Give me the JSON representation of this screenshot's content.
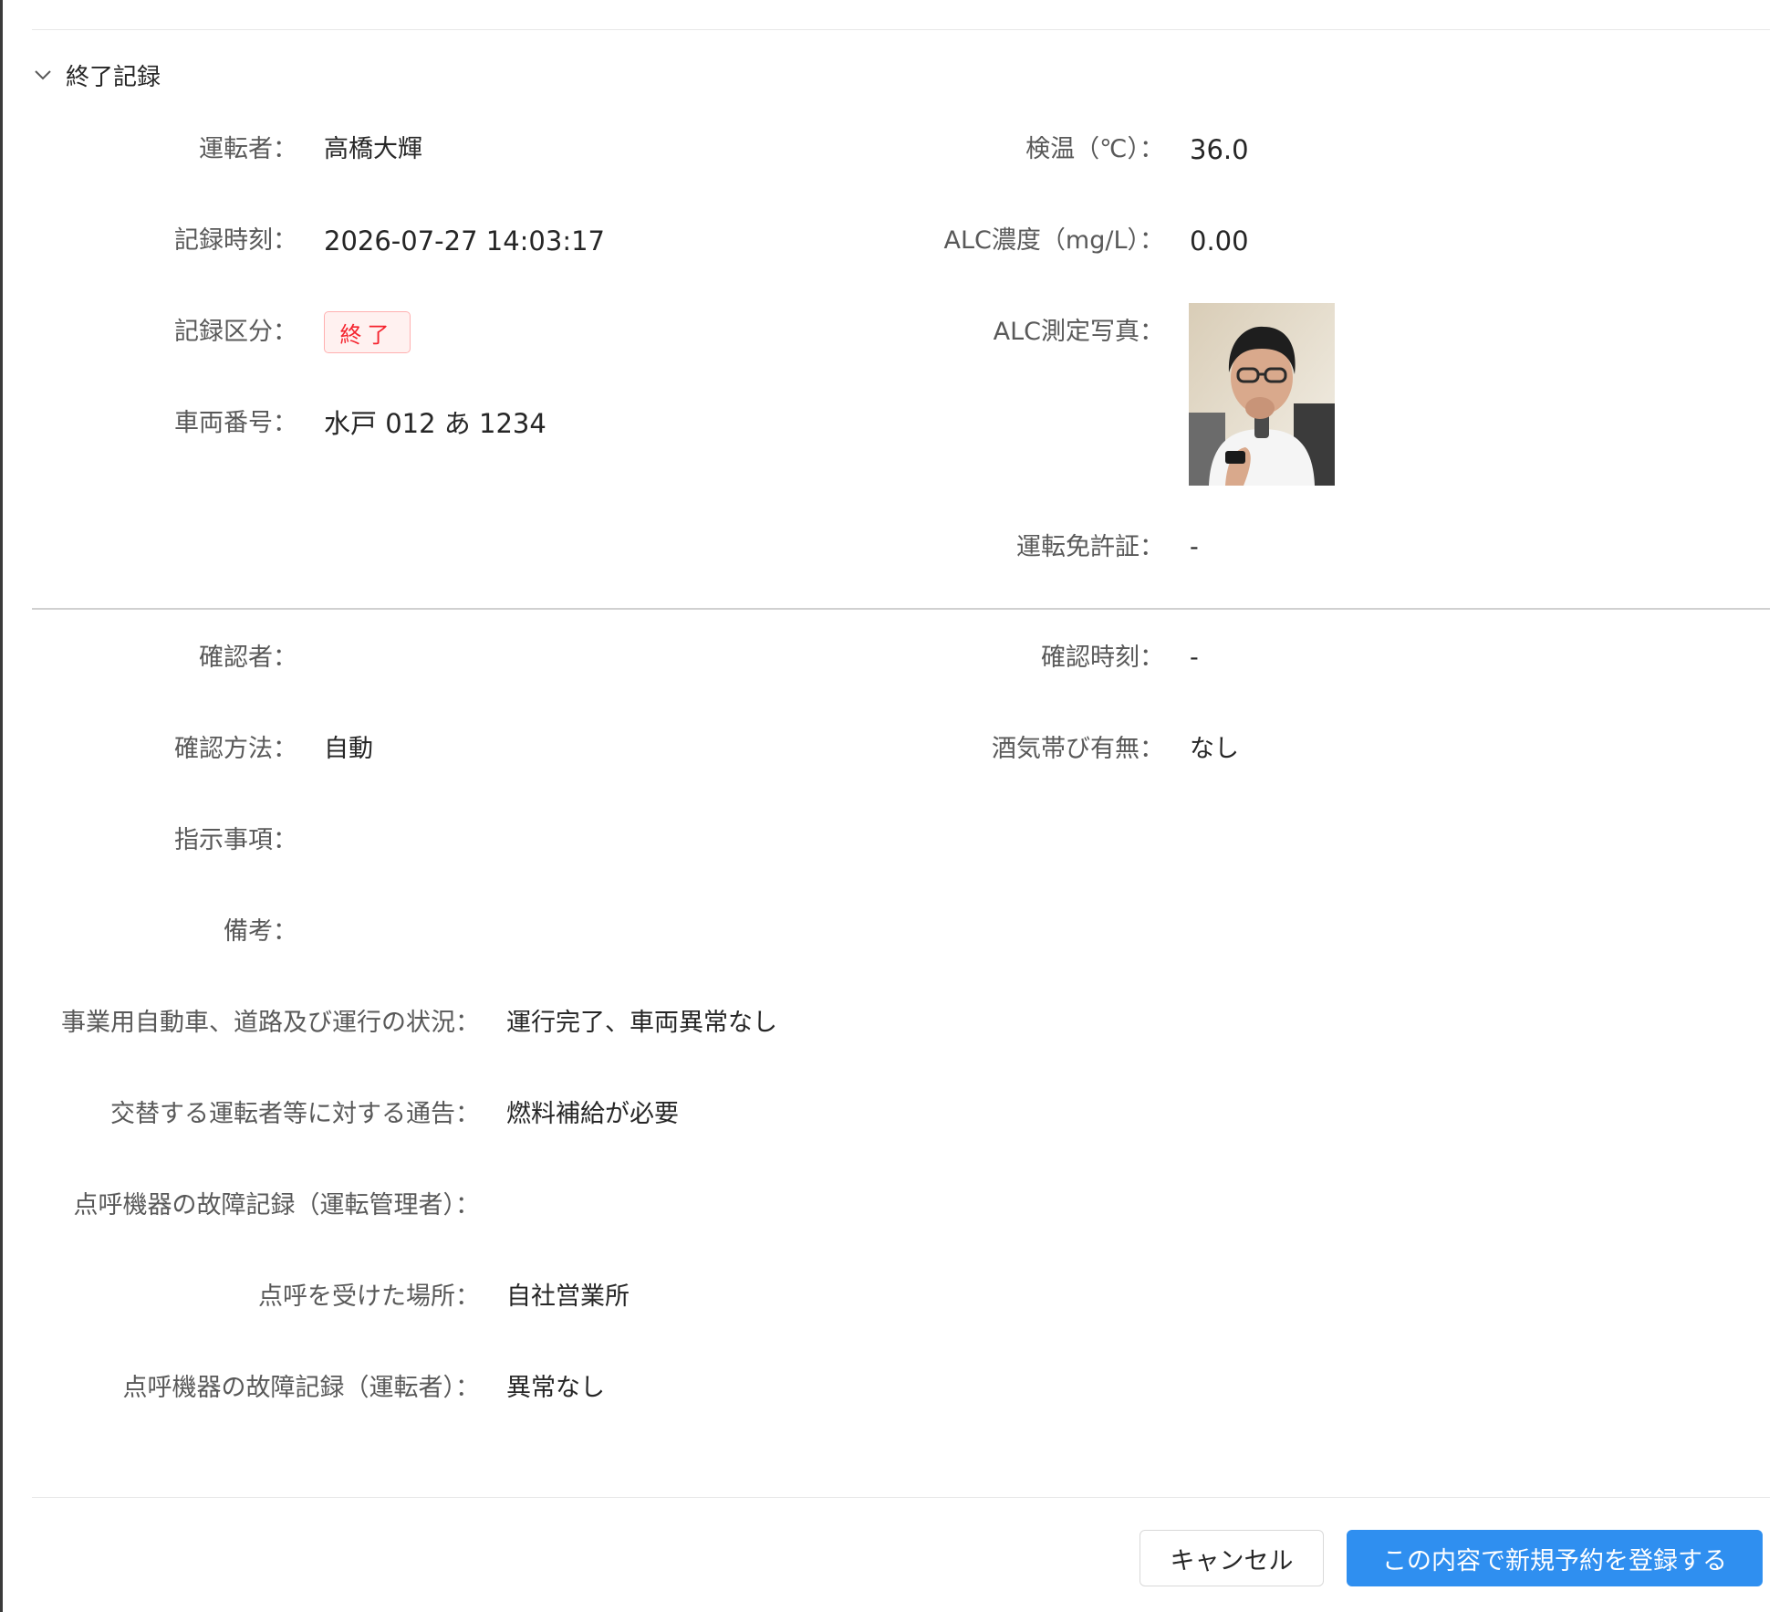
{
  "section": {
    "title": "終了記録"
  },
  "record": {
    "driver_label": "運転者：",
    "driver_value": "高橋大輝",
    "time_label": "記録時刻：",
    "time_value": "2026-07-27 14:03:17",
    "type_label": "記録区分：",
    "type_value": "終了",
    "vehicle_label": "車両番号：",
    "vehicle_value": "水戸 012 あ 1234",
    "temp_label": "検温（℃）：",
    "temp_value": "36.0",
    "alc_label": "ALC濃度（mg/L）：",
    "alc_value": "0.00",
    "photo_label": "ALC測定写真：",
    "license_label": "運転免許証：",
    "license_value": "-"
  },
  "confirm": {
    "confirmer_label": "確認者：",
    "confirmer_value": "",
    "confirm_time_label": "確認時刻：",
    "confirm_time_value": "-",
    "method_label": "確認方法：",
    "method_value": "自動",
    "alcohol_label": "酒気帯び有無：",
    "alcohol_value": "なし",
    "instruction_label": "指示事項：",
    "instruction_value": "",
    "note_label": "備考：",
    "note_value": ""
  },
  "extra": {
    "road_label": "事業用自動車、道路及び運行の状況：",
    "road_value": "運行完了、車両異常なし",
    "notice_label": "交替する運転者等に対する通告：",
    "notice_value": "燃料補給が必要",
    "fault_admin_label": "点呼機器の故障記録（運転管理者）：",
    "fault_admin_value": "",
    "place_label": "点呼を受けた場所：",
    "place_value": "自社営業所",
    "fault_driver_label": "点呼機器の故障記録（運転者）：",
    "fault_driver_value": "異常なし"
  },
  "footer": {
    "cancel_label": "キャンセル",
    "submit_label": "この内容で新規予約を登録する"
  },
  "colors": {
    "primary": "#2f8ff0",
    "tag_red": "#f5222d",
    "tag_bg": "#fff1f0"
  }
}
